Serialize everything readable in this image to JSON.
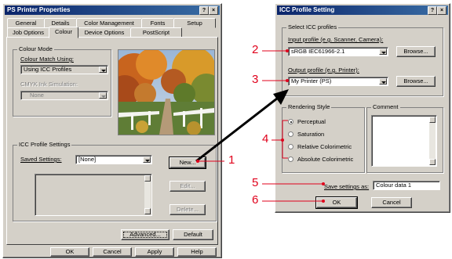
{
  "left_dialog": {
    "title": "PS Printer Properties",
    "title_buttons": [
      "?",
      "×"
    ],
    "tabs_back": [
      "General",
      "Details",
      "Color Management",
      "Fonts",
      "Setup"
    ],
    "tabs_front": [
      "Job Options",
      "Colour",
      "Device Options",
      "PostScript"
    ],
    "colour_mode": {
      "title": "Colour Mode",
      "match_label": "Colour Match Using:",
      "match_value": "Using ICC Profiles",
      "cmyk_label": "CMYK Ink Simulation:",
      "cmyk_value": "None"
    },
    "icc_settings": {
      "title": "ICC Profile Settings",
      "saved_label": "Saved Settings:",
      "saved_value": "[None]",
      "new_button": "New...",
      "edit_button": "Edit...",
      "delete_button": "Delete..."
    },
    "advanced_button": "Advanced...",
    "default_button": "Default",
    "footer_buttons": [
      "OK",
      "Cancel",
      "Apply",
      "Help"
    ]
  },
  "right_dialog": {
    "title": "ICC Profile Setting",
    "title_buttons": [
      "?",
      "×"
    ],
    "profiles_group": "Select ICC profiles",
    "input_label": "Input profile (e.g. Scanner, Camera):",
    "input_value": "sRGB IEC61966-2.1",
    "browse1": "Browse...",
    "output_label": "Output profile (e.g. Printer):",
    "output_value": "My Printer (PS)",
    "browse2": "Browse...",
    "rendering_title": "Rendering Style",
    "rendering_options": [
      "Perceptual",
      "Saturation",
      "Relative Colorimetric",
      "Absolute Colorimetric"
    ],
    "comment_title": "Comment",
    "save_label": "Save settings as:",
    "save_value": "Colour data 1",
    "ok_button": "OK",
    "cancel_button": "Cancel"
  },
  "callouts": [
    "1",
    "2",
    "3",
    "4",
    "5",
    "6"
  ],
  "colors": {
    "callout_red": "#e0001b",
    "titlebar": "#0a246a",
    "face": "#d4d0c8"
  }
}
